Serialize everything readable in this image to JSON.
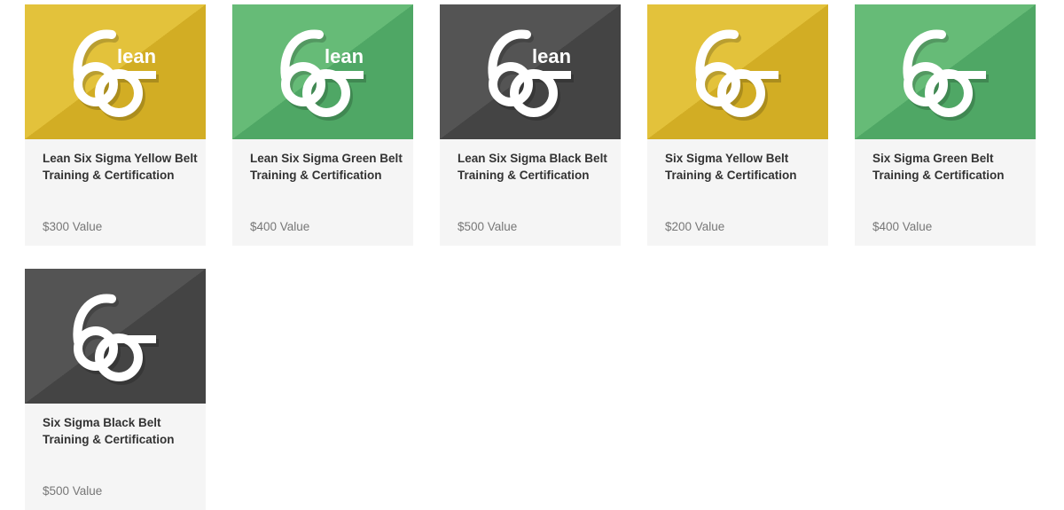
{
  "colors": {
    "yellow": [
      "#e3c23b",
      "#d2ad24"
    ],
    "green": [
      "#66bb77",
      "#4fa765"
    ],
    "black": [
      "#545454",
      "#444444"
    ],
    "card_bg": "#f5f5f5",
    "title_text": "#333333",
    "price_text": "#777777"
  },
  "logo_text": "lean",
  "courses": [
    {
      "title": "Lean Six Sigma Yellow Belt Training & Certification",
      "price": "$300 Value",
      "theme": "yellow",
      "lean": true
    },
    {
      "title": "Lean Six Sigma Green Belt Training & Certification",
      "price": "$400 Value",
      "theme": "green",
      "lean": true
    },
    {
      "title": "Lean Six Sigma Black Belt Training & Certification",
      "price": "$500 Value",
      "theme": "black",
      "lean": true
    },
    {
      "title": "Six Sigma Yellow Belt Training & Certification",
      "price": "$200 Value",
      "theme": "yellow",
      "lean": false
    },
    {
      "title": "Six Sigma Green Belt Training & Certification",
      "price": "$400 Value",
      "theme": "green",
      "lean": false
    },
    {
      "title": "Six Sigma Black Belt Training & Certification",
      "price": "$500 Value",
      "theme": "black",
      "lean": false
    }
  ]
}
